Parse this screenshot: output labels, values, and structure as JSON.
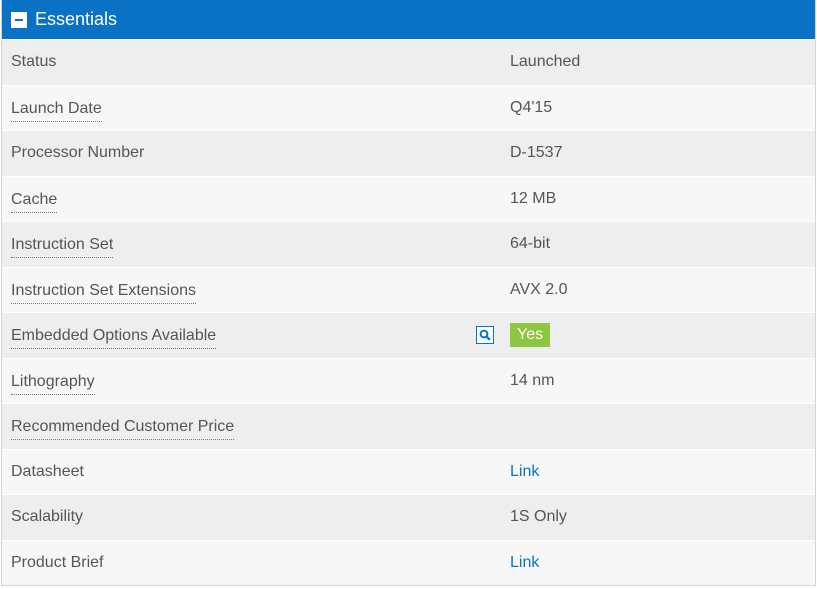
{
  "header": {
    "title": "Essentials"
  },
  "rows": [
    {
      "label": "Status",
      "value": "Launched"
    },
    {
      "label": "Launch Date",
      "value": "Q4'15"
    },
    {
      "label": "Processor Number",
      "value": "D-1537"
    },
    {
      "label": "Cache",
      "value": "12 MB"
    },
    {
      "label": "Instruction Set",
      "value": "64-bit"
    },
    {
      "label": "Instruction Set Extensions",
      "value": "AVX 2.0"
    },
    {
      "label": "Embedded Options Available",
      "value": "Yes"
    },
    {
      "label": "Lithography",
      "value": "14 nm"
    },
    {
      "label": "Recommended Customer Price",
      "value": ""
    },
    {
      "label": "Datasheet",
      "value": "Link"
    },
    {
      "label": "Scalability",
      "value": "1S Only"
    },
    {
      "label": "Product Brief",
      "value": "Link"
    }
  ],
  "colors": {
    "accent": "#0a72c4",
    "badge_yes": "#8dc63f"
  },
  "icons": {
    "collapse": "minus-icon",
    "search": "search-icon"
  }
}
